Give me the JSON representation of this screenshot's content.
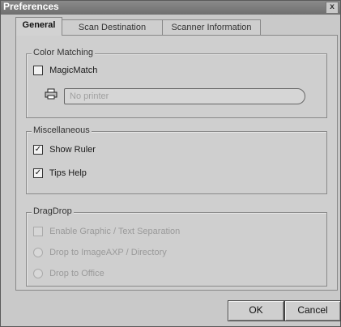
{
  "window": {
    "title": "Preferences",
    "close_glyph": "x"
  },
  "tabs": [
    {
      "label": "General"
    },
    {
      "label": "Scan Destination"
    },
    {
      "label": "Scanner Information"
    }
  ],
  "color_matching": {
    "label": "Color Matching",
    "magicmatch": {
      "label": "MagicMatch",
      "checked": false
    },
    "printer_field": {
      "value": "No printer",
      "icon": "printer-icon"
    }
  },
  "miscellaneous": {
    "label": "Miscellaneous",
    "show_ruler": {
      "label": "Show Ruler",
      "checked": true
    },
    "tips_help": {
      "label": "Tips Help",
      "checked": true
    }
  },
  "dragdrop": {
    "label": "DragDrop",
    "option_checkbox": {
      "label": "Enable Graphic / Text Separation",
      "checked": false,
      "enabled": false
    },
    "radio_1": {
      "label": "Drop to ImageAXP / Directory",
      "enabled": false
    },
    "radio_2": {
      "label": "Drop to Office",
      "enabled": false
    }
  },
  "buttons": {
    "ok": "OK",
    "cancel": "Cancel"
  }
}
